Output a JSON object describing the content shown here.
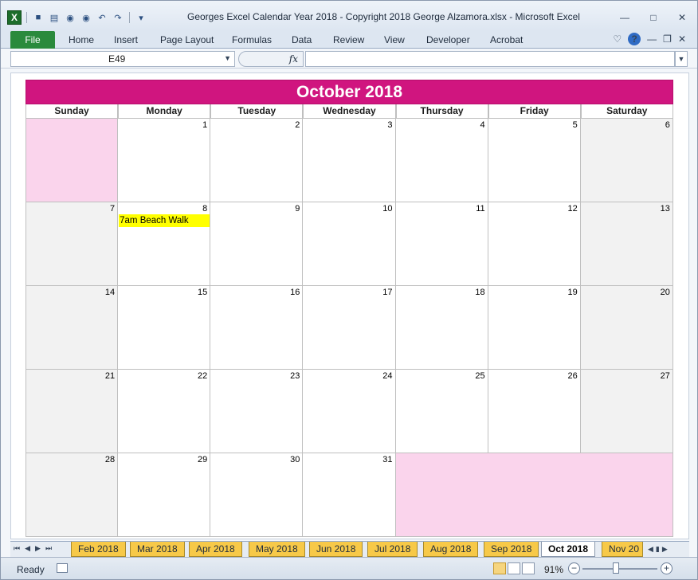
{
  "window": {
    "title": "Georges Excel Calendar Year 2018  -  Copyright 2018 George Alzamora.xlsx  -  Microsoft Excel"
  },
  "ribbon": {
    "file": "File",
    "tabs": [
      "Home",
      "Insert",
      "Page Layout",
      "Formulas",
      "Data",
      "Review",
      "View",
      "Developer",
      "Acrobat"
    ]
  },
  "formula_bar": {
    "name_box": "E49",
    "fx": "fx",
    "formula": ""
  },
  "calendar": {
    "title": "October 2018",
    "days_of_week": [
      "Sunday",
      "Monday",
      "Tuesday",
      "Wednesday",
      "Thursday",
      "Friday",
      "Saturday"
    ],
    "weeks": [
      [
        "",
        "1",
        "2",
        "3",
        "4",
        "5",
        "6"
      ],
      [
        "7",
        "8",
        "9",
        "10",
        "11",
        "12",
        "13"
      ],
      [
        "14",
        "15",
        "16",
        "17",
        "18",
        "19",
        "20"
      ],
      [
        "21",
        "22",
        "23",
        "24",
        "25",
        "26",
        "27"
      ],
      [
        "28",
        "29",
        "30",
        "31",
        "",
        "",
        ""
      ]
    ],
    "event": {
      "day": "8",
      "text": "7am Beach Walk"
    },
    "colors": {
      "header": "#d0157f",
      "empty": "#fad4ec",
      "weekend": "#f2f2f2",
      "event": "#ffff00"
    }
  },
  "sheet_tabs": [
    "Feb 2018",
    "Mar 2018",
    "Apr 2018",
    "May 2018",
    "Jun 2018",
    "Jul 2018",
    "Aug 2018",
    "Sep 2018",
    "Oct 2018",
    "Nov 20"
  ],
  "active_tab": "Oct 2018",
  "status": {
    "ready": "Ready",
    "zoom": "91%"
  }
}
